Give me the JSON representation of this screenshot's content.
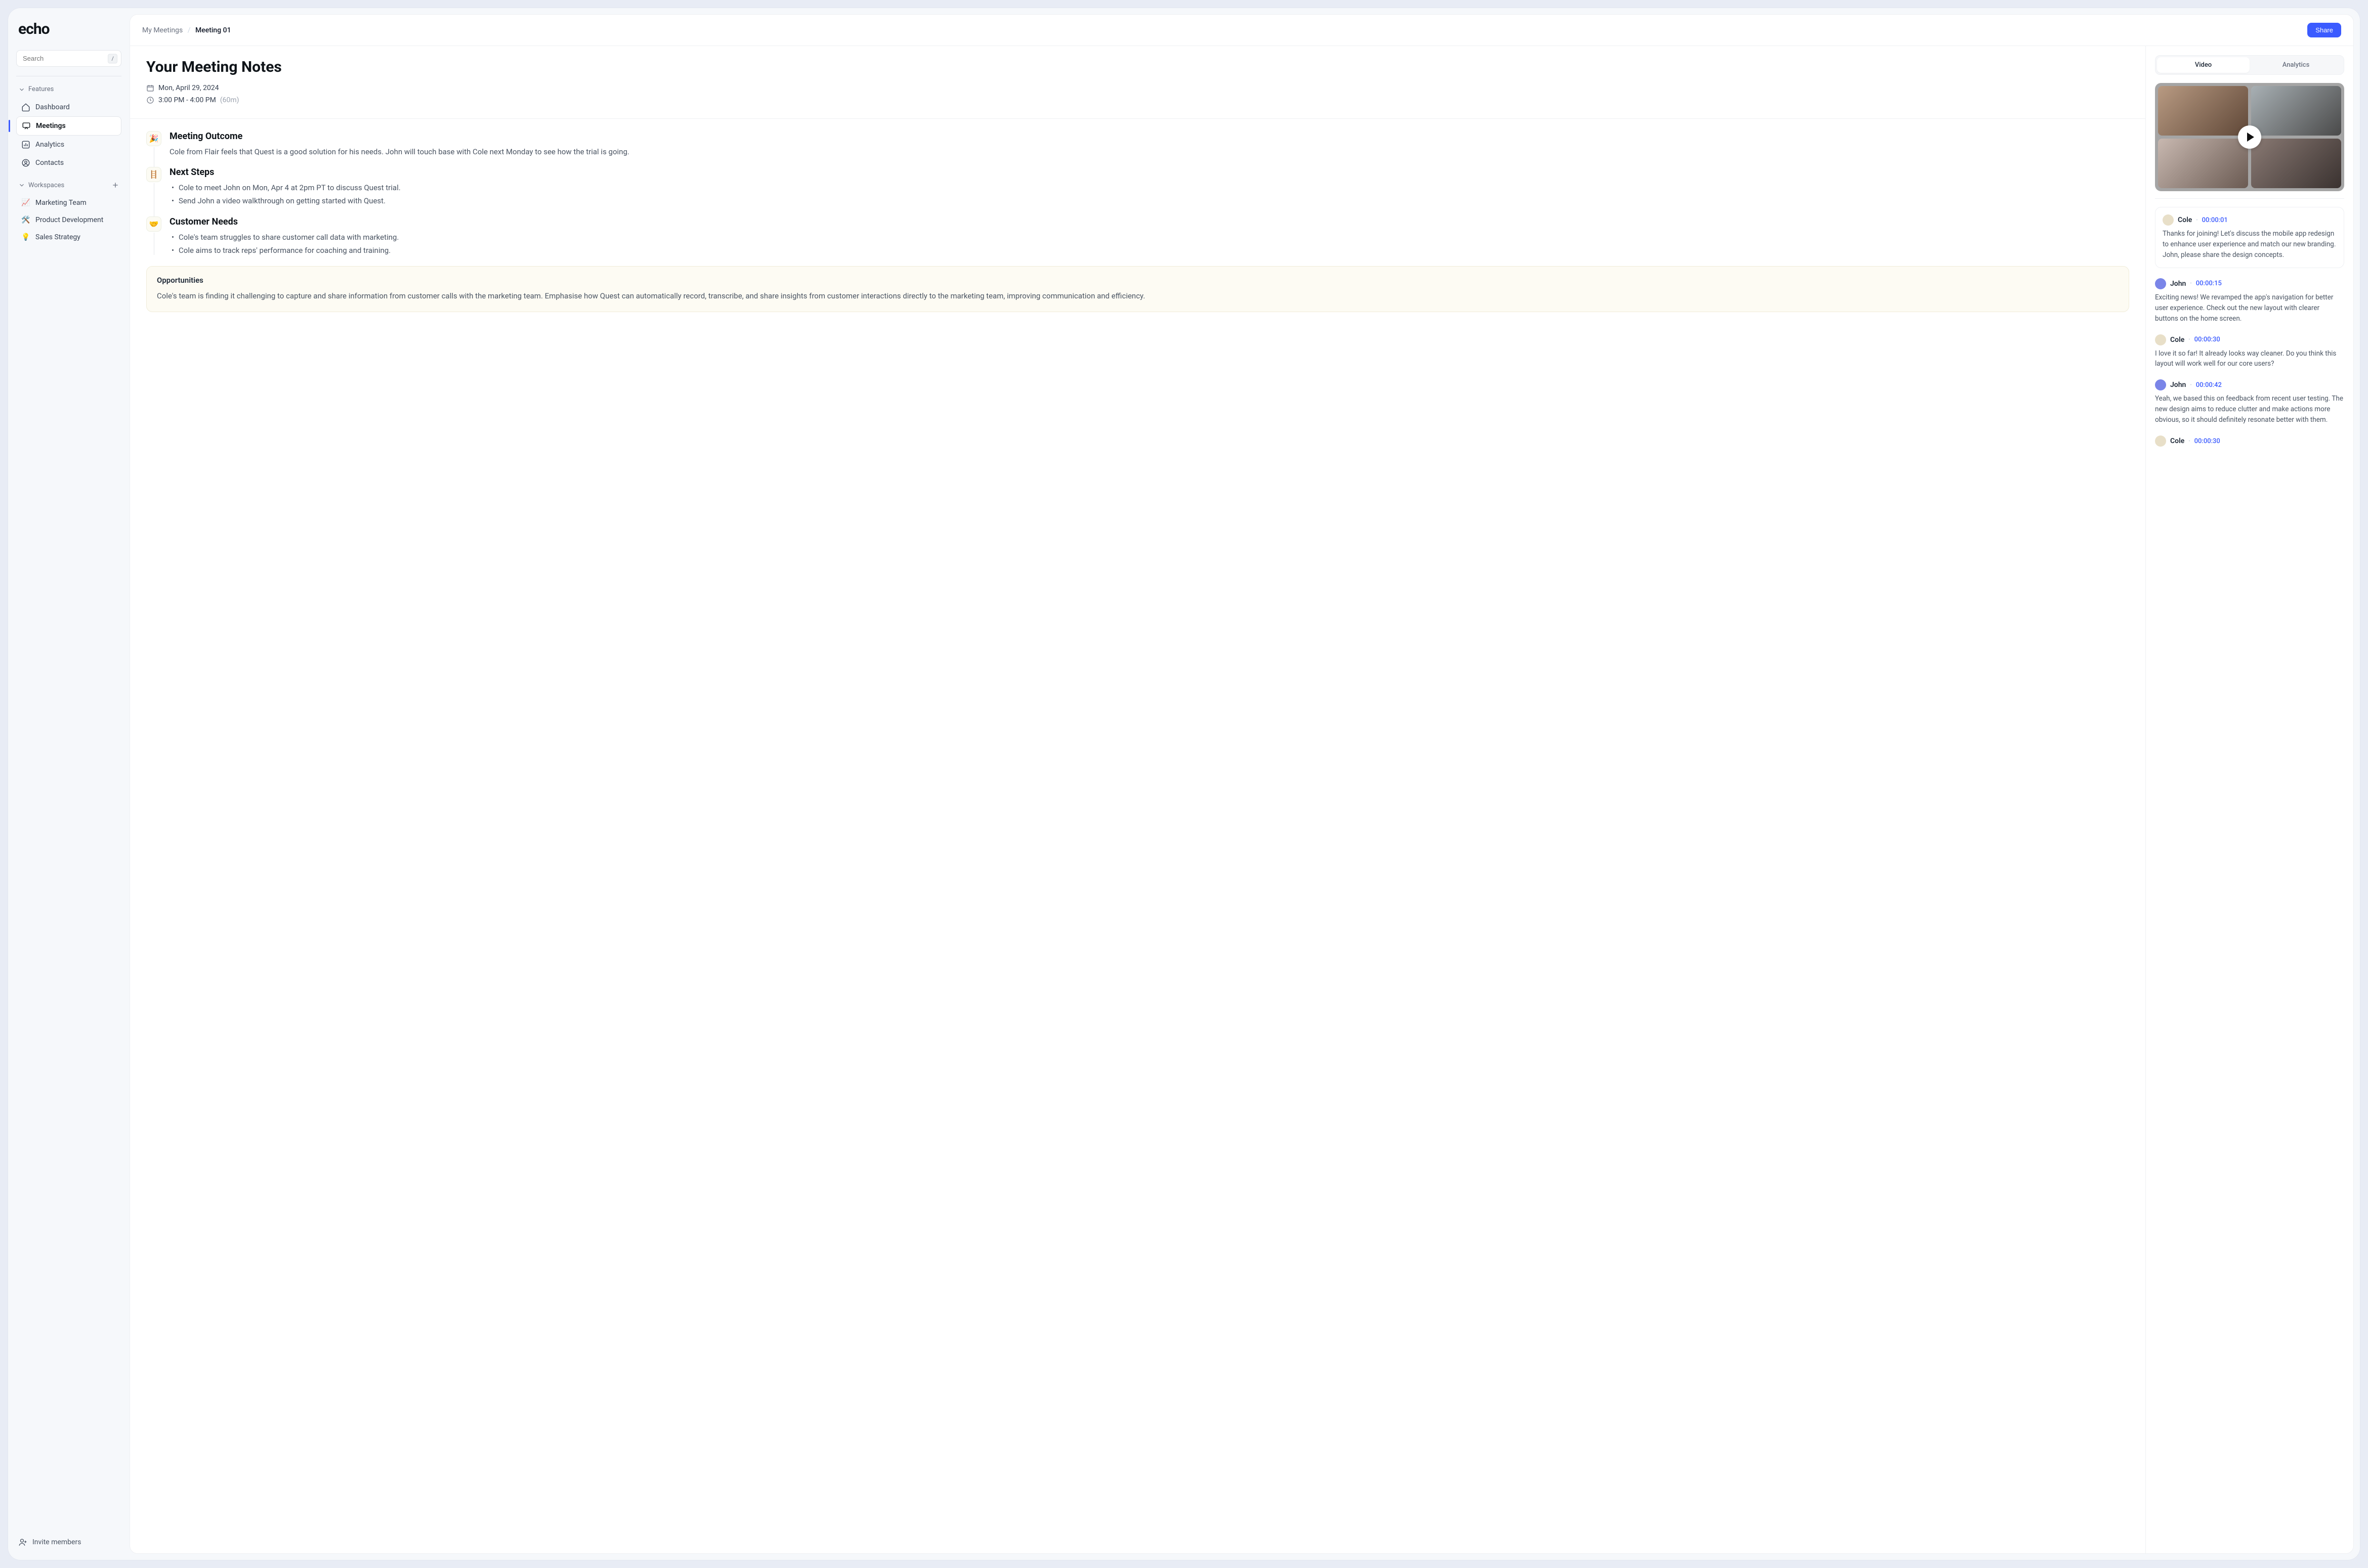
{
  "logo": "echo",
  "search": {
    "placeholder": "Search",
    "shortcut": "/"
  },
  "sections": {
    "features": {
      "label": "Features"
    },
    "workspaces": {
      "label": "Workspaces"
    }
  },
  "nav": {
    "dashboard": "Dashboard",
    "meetings": "Meetings",
    "analytics": "Analytics",
    "contacts": "Contacts"
  },
  "workspaces": [
    {
      "emoji": "📈",
      "label": "Marketing Team"
    },
    {
      "emoji": "🛠️",
      "label": "Product Development"
    },
    {
      "emoji": "💡",
      "label": "Sales Strategy"
    }
  ],
  "invite": "Invite members",
  "breadcrumb": {
    "parent": "My Meetings",
    "current": "Meeting 01"
  },
  "share": "Share",
  "title": "Your Meeting Notes",
  "date": "Mon, April 29, 2024",
  "time": "3:00 PM - 4:00 PM",
  "duration": "(60m)",
  "blocks": {
    "outcome": {
      "emoji": "🎉",
      "title": "Meeting Outcome",
      "text": "Cole from Flair feels that Quest is a good solution for his needs. John will touch base with Cole next Monday to see how the trial is going."
    },
    "next": {
      "emoji": "🪜",
      "title": "Next Steps",
      "items": [
        "Cole to meet John on Mon, Apr 4 at 2pm PT to discuss Quest trial.",
        "Send John a video walkthrough on getting started with Quest."
      ]
    },
    "needs": {
      "emoji": "🤝",
      "title": "Customer Needs",
      "items": [
        "Cole's team struggles to share customer call data with marketing.",
        "Cole aims to track reps' performance for coaching and training."
      ]
    }
  },
  "callout": {
    "title": "Opportunities",
    "text": "Cole's team is finding it challenging to capture and share information from customer calls with the marketing team. Emphasise how Quest can automatically record, transcribe, and share insights from customer interactions directly to the marketing team, improving communication and efficiency."
  },
  "tabs": {
    "video": "Video",
    "analytics": "Analytics"
  },
  "transcript": [
    {
      "speaker": "Cole",
      "avatar": "cole",
      "time": "00:00:01",
      "text": "Thanks for joining! Let's discuss the mobile app redesign to enhance user experience and match our new branding. John, please share the design concepts.",
      "boxed": true
    },
    {
      "speaker": "John",
      "avatar": "john",
      "time": "00:00:15",
      "text": "Exciting news! We revamped the app's navigation for better user experience. Check out the new layout with clearer buttons on the home screen."
    },
    {
      "speaker": "Cole",
      "avatar": "cole",
      "time": "00:00:30",
      "text": "I love it so far! It already looks way cleaner. Do you think this layout will work well for our core users?"
    },
    {
      "speaker": "John",
      "avatar": "john",
      "time": "00:00:42",
      "text": "Yeah, we based this on feedback from recent user testing. The new design aims to reduce clutter and make actions more obvious, so it should definitely resonate better with them."
    },
    {
      "speaker": "Cole",
      "avatar": "cole",
      "time": "00:00:30",
      "text": ""
    }
  ]
}
